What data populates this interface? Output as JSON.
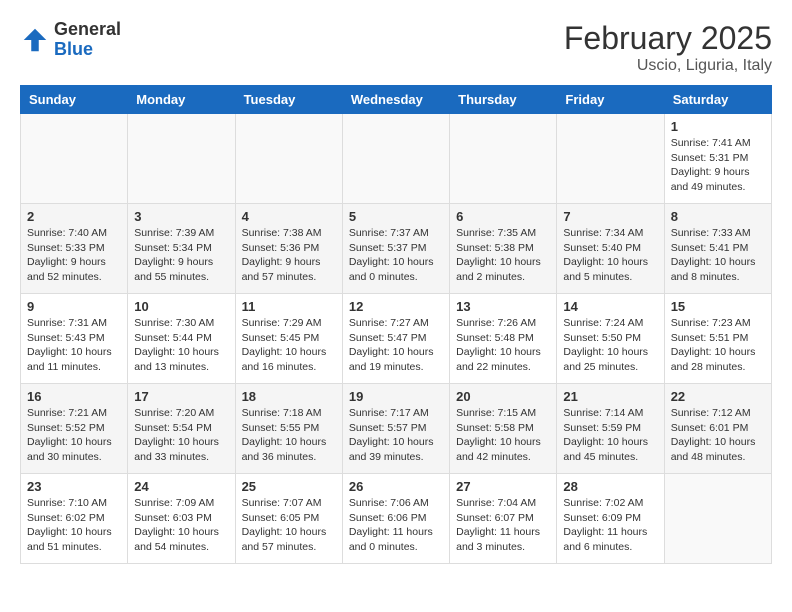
{
  "header": {
    "logo_general": "General",
    "logo_blue": "Blue",
    "title": "February 2025",
    "subtitle": "Uscio, Liguria, Italy"
  },
  "weekdays": [
    "Sunday",
    "Monday",
    "Tuesday",
    "Wednesday",
    "Thursday",
    "Friday",
    "Saturday"
  ],
  "weeks": [
    [
      {
        "day": "",
        "info": ""
      },
      {
        "day": "",
        "info": ""
      },
      {
        "day": "",
        "info": ""
      },
      {
        "day": "",
        "info": ""
      },
      {
        "day": "",
        "info": ""
      },
      {
        "day": "",
        "info": ""
      },
      {
        "day": "1",
        "info": "Sunrise: 7:41 AM\nSunset: 5:31 PM\nDaylight: 9 hours\nand 49 minutes."
      }
    ],
    [
      {
        "day": "2",
        "info": "Sunrise: 7:40 AM\nSunset: 5:33 PM\nDaylight: 9 hours\nand 52 minutes."
      },
      {
        "day": "3",
        "info": "Sunrise: 7:39 AM\nSunset: 5:34 PM\nDaylight: 9 hours\nand 55 minutes."
      },
      {
        "day": "4",
        "info": "Sunrise: 7:38 AM\nSunset: 5:36 PM\nDaylight: 9 hours\nand 57 minutes."
      },
      {
        "day": "5",
        "info": "Sunrise: 7:37 AM\nSunset: 5:37 PM\nDaylight: 10 hours\nand 0 minutes."
      },
      {
        "day": "6",
        "info": "Sunrise: 7:35 AM\nSunset: 5:38 PM\nDaylight: 10 hours\nand 2 minutes."
      },
      {
        "day": "7",
        "info": "Sunrise: 7:34 AM\nSunset: 5:40 PM\nDaylight: 10 hours\nand 5 minutes."
      },
      {
        "day": "8",
        "info": "Sunrise: 7:33 AM\nSunset: 5:41 PM\nDaylight: 10 hours\nand 8 minutes."
      }
    ],
    [
      {
        "day": "9",
        "info": "Sunrise: 7:31 AM\nSunset: 5:43 PM\nDaylight: 10 hours\nand 11 minutes."
      },
      {
        "day": "10",
        "info": "Sunrise: 7:30 AM\nSunset: 5:44 PM\nDaylight: 10 hours\nand 13 minutes."
      },
      {
        "day": "11",
        "info": "Sunrise: 7:29 AM\nSunset: 5:45 PM\nDaylight: 10 hours\nand 16 minutes."
      },
      {
        "day": "12",
        "info": "Sunrise: 7:27 AM\nSunset: 5:47 PM\nDaylight: 10 hours\nand 19 minutes."
      },
      {
        "day": "13",
        "info": "Sunrise: 7:26 AM\nSunset: 5:48 PM\nDaylight: 10 hours\nand 22 minutes."
      },
      {
        "day": "14",
        "info": "Sunrise: 7:24 AM\nSunset: 5:50 PM\nDaylight: 10 hours\nand 25 minutes."
      },
      {
        "day": "15",
        "info": "Sunrise: 7:23 AM\nSunset: 5:51 PM\nDaylight: 10 hours\nand 28 minutes."
      }
    ],
    [
      {
        "day": "16",
        "info": "Sunrise: 7:21 AM\nSunset: 5:52 PM\nDaylight: 10 hours\nand 30 minutes."
      },
      {
        "day": "17",
        "info": "Sunrise: 7:20 AM\nSunset: 5:54 PM\nDaylight: 10 hours\nand 33 minutes."
      },
      {
        "day": "18",
        "info": "Sunrise: 7:18 AM\nSunset: 5:55 PM\nDaylight: 10 hours\nand 36 minutes."
      },
      {
        "day": "19",
        "info": "Sunrise: 7:17 AM\nSunset: 5:57 PM\nDaylight: 10 hours\nand 39 minutes."
      },
      {
        "day": "20",
        "info": "Sunrise: 7:15 AM\nSunset: 5:58 PM\nDaylight: 10 hours\nand 42 minutes."
      },
      {
        "day": "21",
        "info": "Sunrise: 7:14 AM\nSunset: 5:59 PM\nDaylight: 10 hours\nand 45 minutes."
      },
      {
        "day": "22",
        "info": "Sunrise: 7:12 AM\nSunset: 6:01 PM\nDaylight: 10 hours\nand 48 minutes."
      }
    ],
    [
      {
        "day": "23",
        "info": "Sunrise: 7:10 AM\nSunset: 6:02 PM\nDaylight: 10 hours\nand 51 minutes."
      },
      {
        "day": "24",
        "info": "Sunrise: 7:09 AM\nSunset: 6:03 PM\nDaylight: 10 hours\nand 54 minutes."
      },
      {
        "day": "25",
        "info": "Sunrise: 7:07 AM\nSunset: 6:05 PM\nDaylight: 10 hours\nand 57 minutes."
      },
      {
        "day": "26",
        "info": "Sunrise: 7:06 AM\nSunset: 6:06 PM\nDaylight: 11 hours\nand 0 minutes."
      },
      {
        "day": "27",
        "info": "Sunrise: 7:04 AM\nSunset: 6:07 PM\nDaylight: 11 hours\nand 3 minutes."
      },
      {
        "day": "28",
        "info": "Sunrise: 7:02 AM\nSunset: 6:09 PM\nDaylight: 11 hours\nand 6 minutes."
      },
      {
        "day": "",
        "info": ""
      }
    ]
  ]
}
